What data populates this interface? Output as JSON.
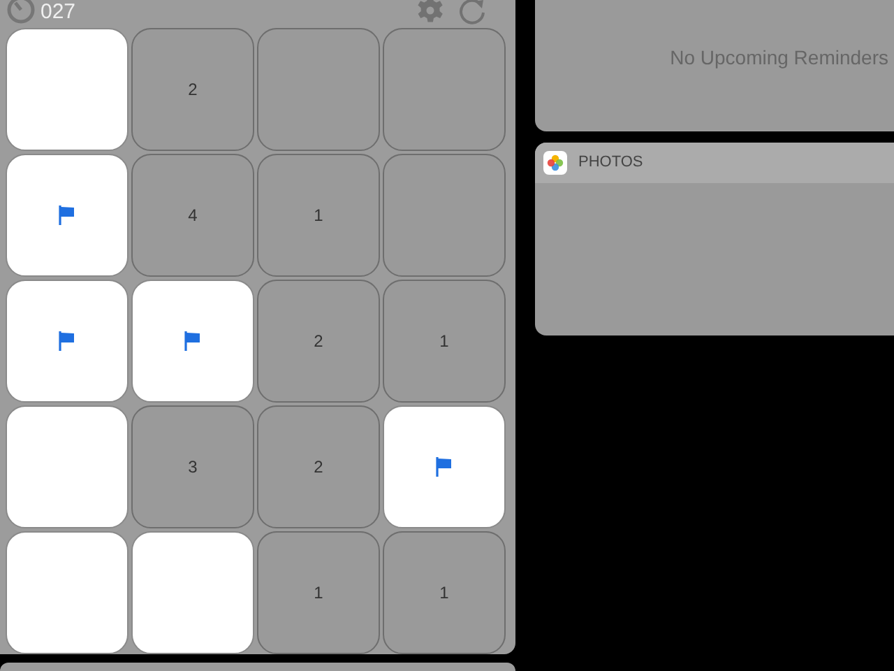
{
  "minesweeper": {
    "timer": "027",
    "tiles": [
      {
        "kind": "covered"
      },
      {
        "kind": "revealed",
        "number": "2"
      },
      {
        "kind": "revealed"
      },
      {
        "kind": "revealed"
      },
      {
        "kind": "flag"
      },
      {
        "kind": "revealed",
        "number": "4"
      },
      {
        "kind": "revealed",
        "number": "1"
      },
      {
        "kind": "revealed"
      },
      {
        "kind": "flag"
      },
      {
        "kind": "flag"
      },
      {
        "kind": "revealed",
        "number": "2"
      },
      {
        "kind": "revealed",
        "number": "1"
      },
      {
        "kind": "covered"
      },
      {
        "kind": "revealed",
        "number": "3"
      },
      {
        "kind": "revealed",
        "number": "2"
      },
      {
        "kind": "flag"
      },
      {
        "kind": "covered"
      },
      {
        "kind": "covered"
      },
      {
        "kind": "revealed",
        "number": "1"
      },
      {
        "kind": "revealed",
        "number": "1"
      }
    ]
  },
  "reminders": {
    "message": "No Upcoming Reminders"
  },
  "photos": {
    "title": "PHOTOS"
  }
}
